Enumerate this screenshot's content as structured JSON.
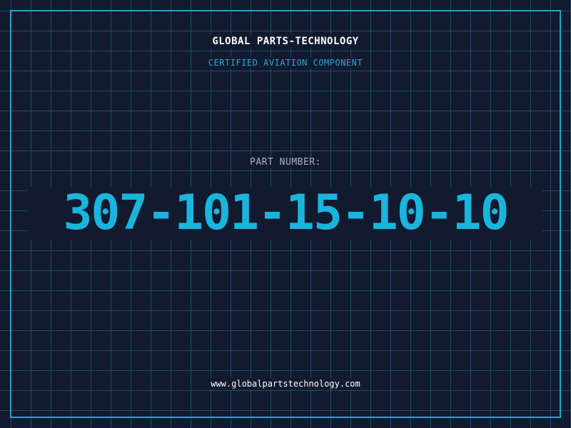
{
  "brand": {
    "name": "GLOBAL PARTS-TECHNOLOGY",
    "tagline": "CERTIFIED AVIATION COMPONENT"
  },
  "part": {
    "label": "PART NUMBER:",
    "number": "307-101-15-10-10"
  },
  "footer": {
    "website": "www.globalpartstechnology.com"
  },
  "colors": {
    "background": "#111a2e",
    "grid": "#1f4d66",
    "frame": "#1fa6c9",
    "accent": "#19b5dd",
    "text": "#ffffff",
    "label": "#a9b4c2"
  }
}
